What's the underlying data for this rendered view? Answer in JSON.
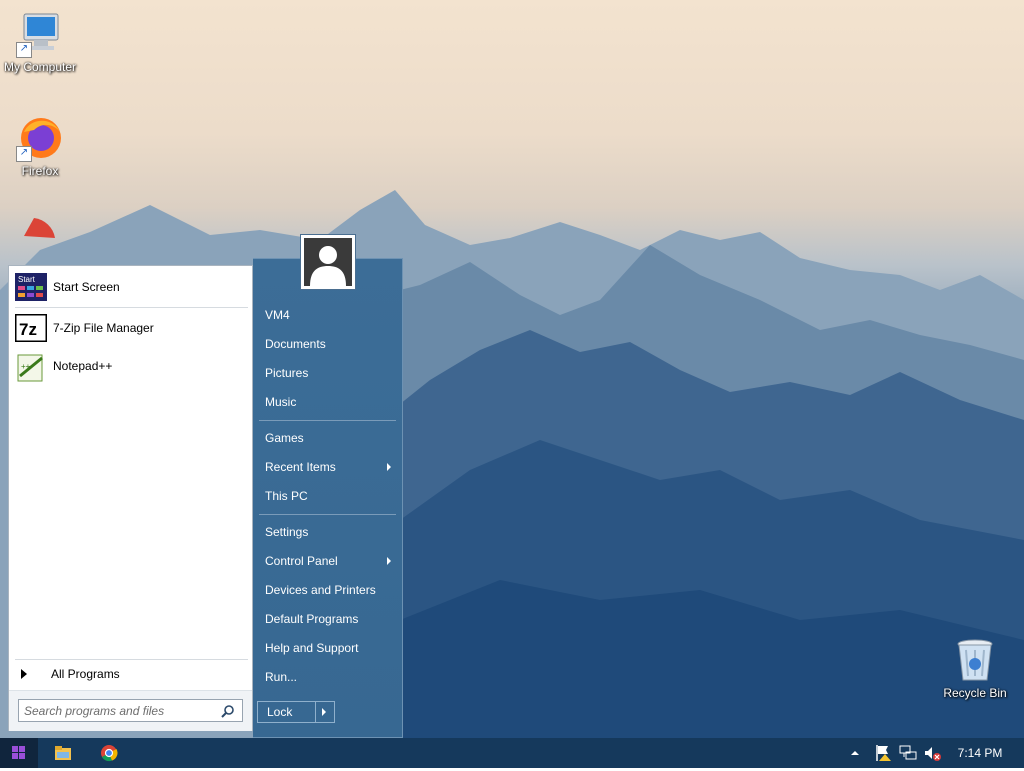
{
  "desktop": {
    "icons": [
      {
        "label": "My Computer"
      },
      {
        "label": "Firefox"
      },
      {
        "label": "Recycle Bin"
      }
    ]
  },
  "start_menu": {
    "pinned": [
      {
        "label": "Start Screen",
        "icon": "start-screen-icon"
      },
      {
        "label": "7-Zip File Manager",
        "icon": "7zip-icon"
      },
      {
        "label": "Notepad++",
        "icon": "notepadpp-icon"
      }
    ],
    "all_programs": "All Programs",
    "search": {
      "placeholder": "Search programs and files",
      "value": ""
    },
    "right": {
      "items": [
        {
          "label": "VM4"
        },
        {
          "label": "Documents"
        },
        {
          "label": "Pictures"
        },
        {
          "label": "Music"
        },
        {
          "label": "Games"
        },
        {
          "label": "Recent Items",
          "submenu": true
        },
        {
          "label": "This PC"
        },
        {
          "label": "Settings"
        },
        {
          "label": "Control Panel",
          "submenu": true
        },
        {
          "label": "Devices and Printers"
        },
        {
          "label": "Default Programs"
        },
        {
          "label": "Help and Support"
        },
        {
          "label": "Run..."
        }
      ],
      "lock_label": "Lock"
    }
  },
  "taskbar": {
    "clock": "7:14 PM",
    "tray_icons": [
      "tray-expand-icon",
      "action-center-flag-icon",
      "network-icon",
      "volume-muted-icon"
    ]
  },
  "colors": {
    "start_right_bg": "#3c6d97",
    "taskbar_bg": "#15395c"
  }
}
